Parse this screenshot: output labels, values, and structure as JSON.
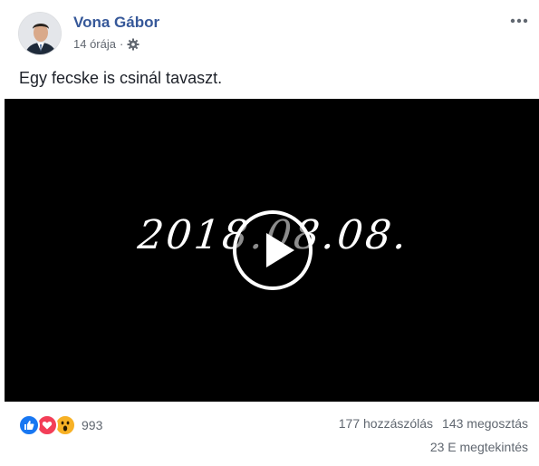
{
  "post": {
    "author": "Vona Gábor",
    "time": "14 órája",
    "separator": "·",
    "privacy_icon": "gear-icon",
    "more_icon": "more-options-icon",
    "text": "Egy fecske is csinál tavaszt."
  },
  "video": {
    "overlay_text": "2018.08.08.",
    "play_icon": "play-icon"
  },
  "reactions": {
    "icons": [
      "like-icon",
      "love-icon",
      "wow-icon"
    ],
    "count": "993"
  },
  "stats": {
    "comments": "177 hozzászólás",
    "shares": "143 megosztás",
    "views": "23 E megtekintés"
  },
  "colors": {
    "author_link": "#365899",
    "meta_text": "#616770",
    "video_background": "#000000",
    "like": "#1877f2",
    "love": "#f33e58",
    "wow": "#f7b125"
  }
}
